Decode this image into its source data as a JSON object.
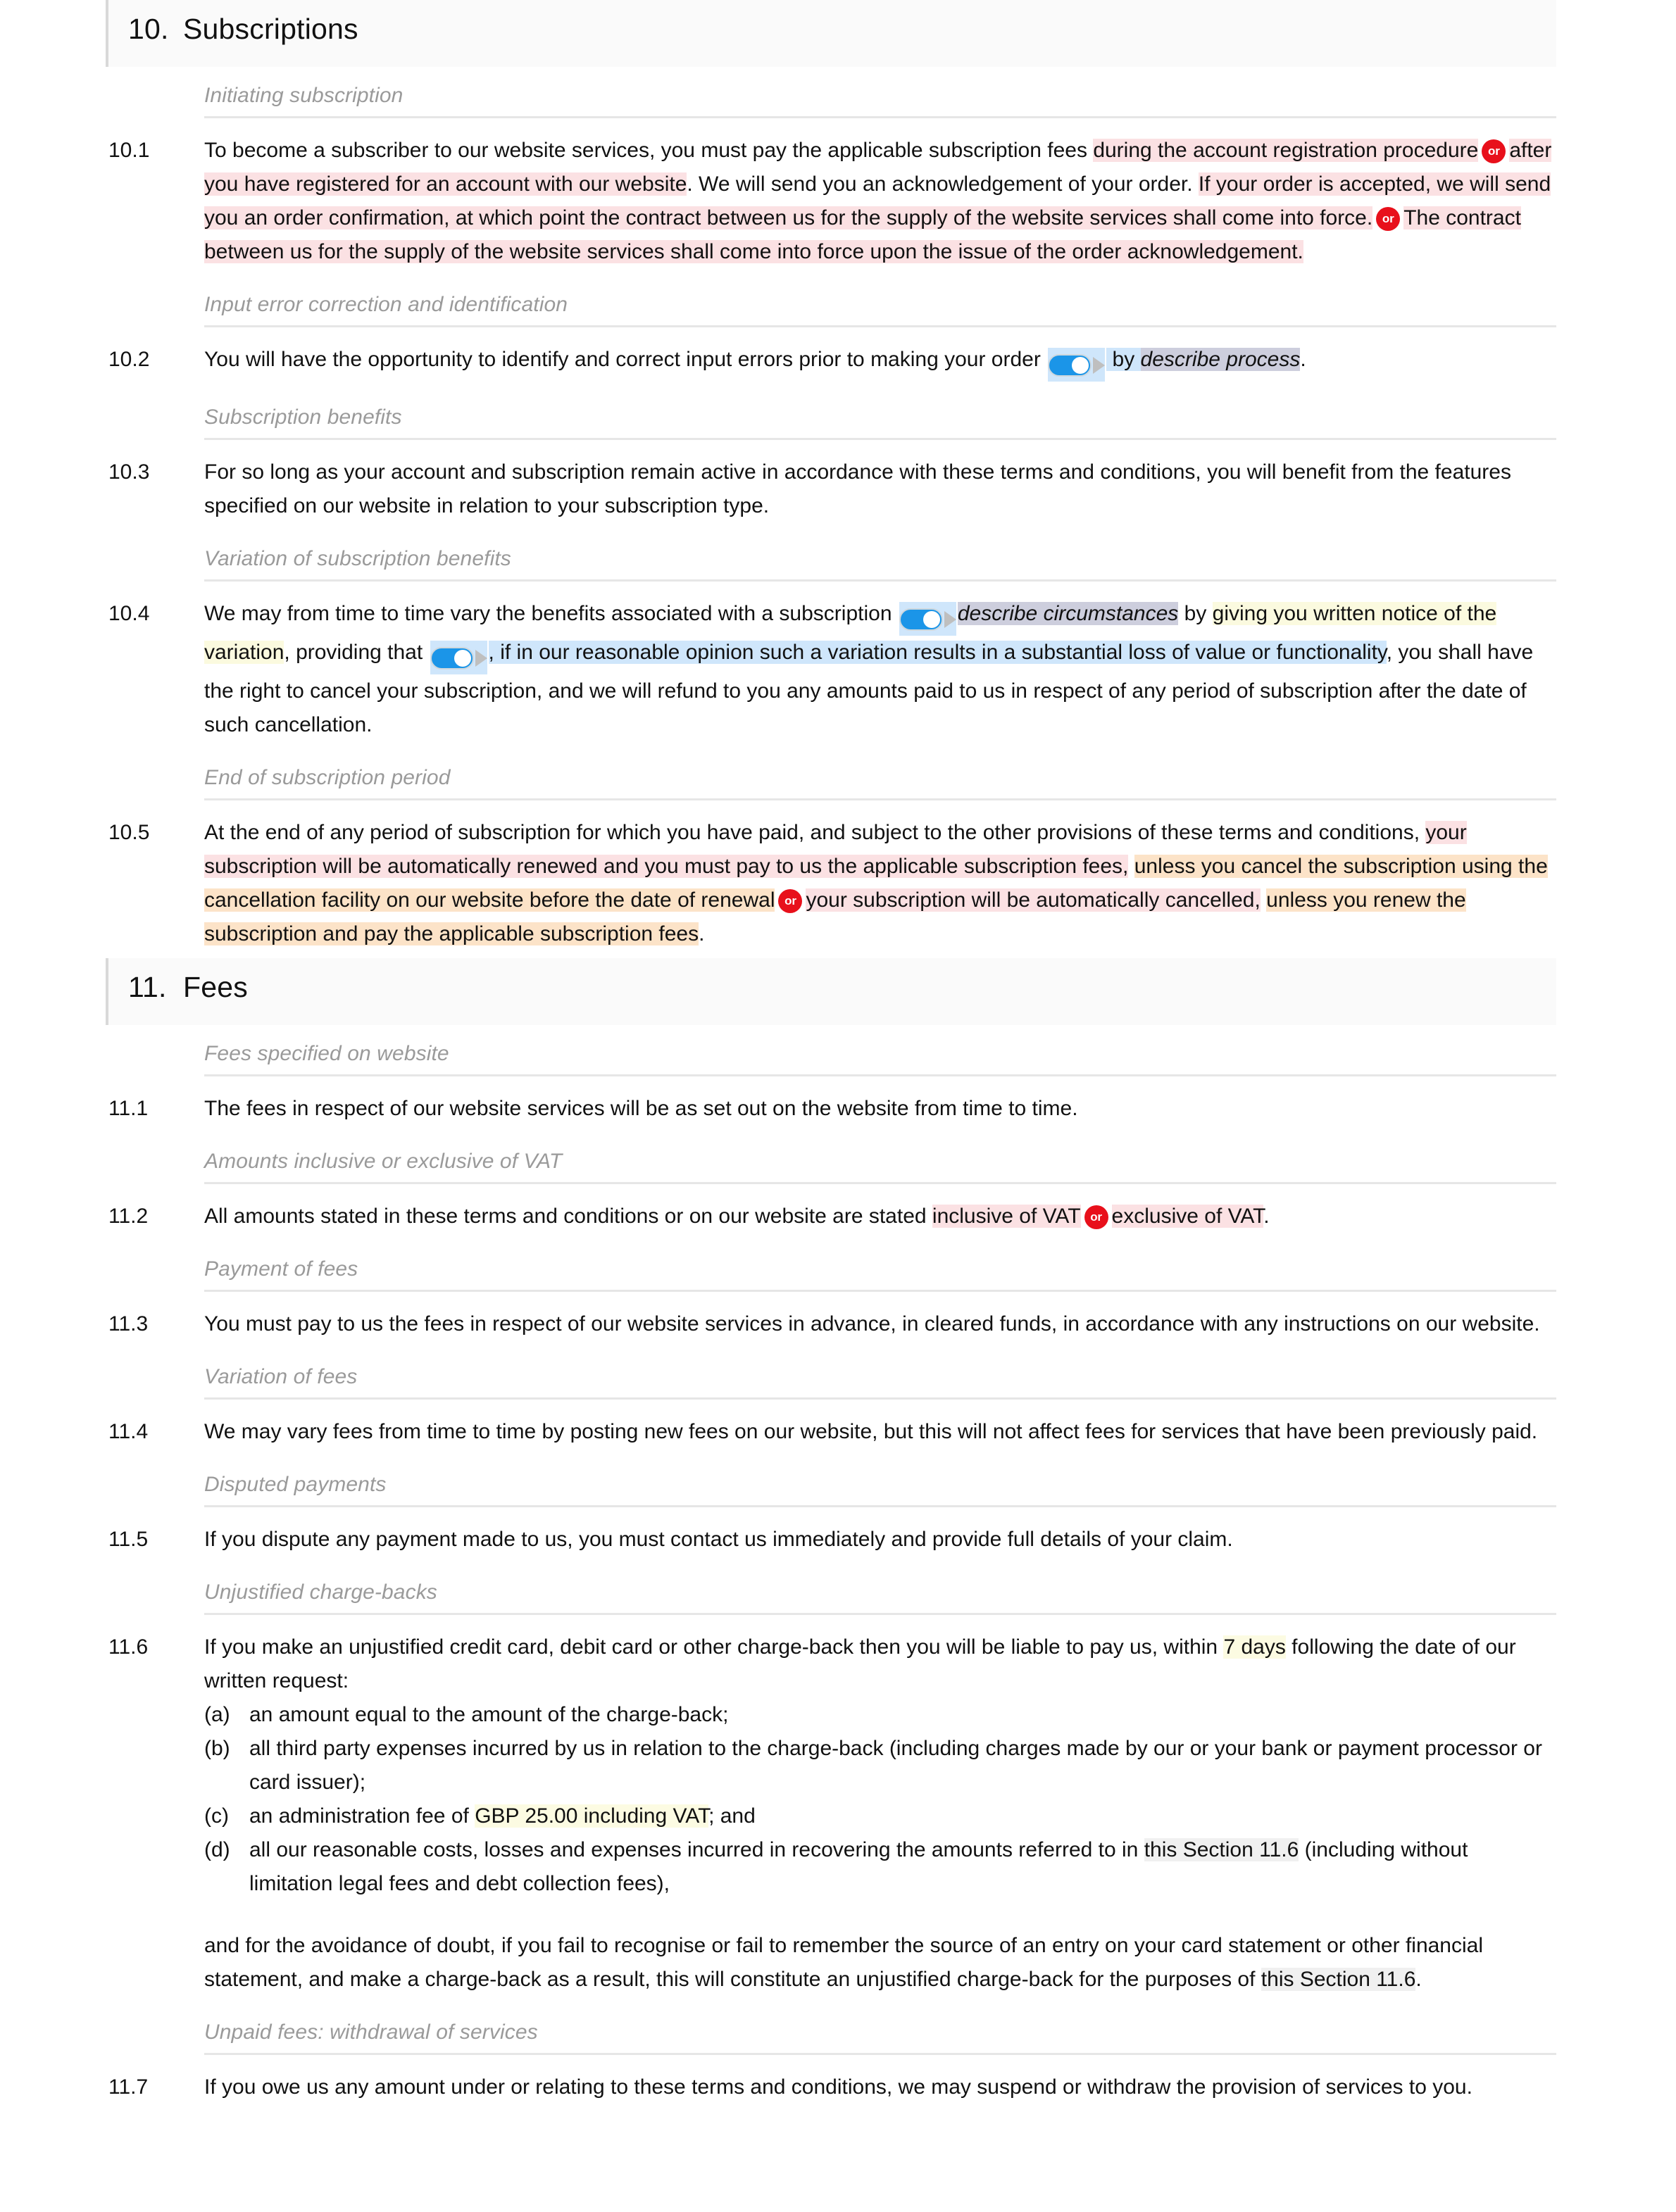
{
  "sections": [
    {
      "number": "10.",
      "title": "Subscriptions",
      "groups": [
        {
          "subheading": "Initiating subscription",
          "clauses": [
            {
              "number": "10.1",
              "runs": [
                {
                  "t": "To become a subscriber to our website services, you must pay the applicable subscription fees "
                },
                {
                  "t": "during the account registration procedure",
                  "hl": "pink"
                },
                {
                  "badge": "or"
                },
                {
                  "t": "after you have registered for an account with our website",
                  "hl": "pink"
                },
                {
                  "t": ". We will send you an acknowledgement of your order. "
                },
                {
                  "t": "If your order is accepted, we will send you an order confirmation, at which point the contract between us for the supply of the website services shall come into force.",
                  "hl": "pink"
                },
                {
                  "badge": "or"
                },
                {
                  "t": "The contract between us for the supply of the website services shall come into force upon the issue of the order acknowledgement.",
                  "hl": "pink"
                }
              ]
            }
          ]
        },
        {
          "subheading": "Input error correction and identification",
          "clauses": [
            {
              "number": "10.2",
              "runs": [
                {
                  "t": "You will have the opportunity to identify and correct input errors prior to making your order "
                },
                {
                  "toggle": true
                },
                {
                  "t": " by ",
                  "hl": "blue_plain"
                },
                {
                  "t": "describe process",
                  "hl": "lav",
                  "italic": true
                },
                {
                  "t": "."
                }
              ]
            }
          ]
        },
        {
          "subheading": "Subscription benefits",
          "clauses": [
            {
              "number": "10.3",
              "runs": [
                {
                  "t": "For so long as your account and subscription remain active in accordance with these terms and conditions, you will benefit from the features specified on our website in relation to your subscription type."
                }
              ]
            }
          ]
        },
        {
          "subheading": "Variation of subscription benefits",
          "clauses": [
            {
              "number": "10.4",
              "runs": [
                {
                  "t": "We may from time to time vary the benefits associated with a subscription "
                },
                {
                  "toggle": true
                },
                {
                  "t": "describe circumstances",
                  "hl": "lav",
                  "italic": true
                },
                {
                  "t": " by "
                },
                {
                  "t": "giving you written notice of the variation",
                  "hl": "yellow"
                },
                {
                  "t": ", providing that "
                },
                {
                  "toggle2": true
                },
                {
                  "t": ", if in our reasonable opinion such a variation results in a substantial loss of value or functionality",
                  "hl": "blue"
                },
                {
                  "t": ", you shall have the right to cancel your subscription, and we will refund to you any amounts paid to us in respect of any period of subscription after the date of such cancellation."
                }
              ]
            }
          ]
        },
        {
          "subheading": "End of subscription period",
          "clauses": [
            {
              "number": "10.5",
              "runs": [
                {
                  "t": "At the end of any period of subscription for which you have paid, and subject to the other provisions of these terms and conditions, "
                },
                {
                  "t": "your subscription will be automatically renewed and you must pay to us the applicable subscription fees,",
                  "hl": "pink"
                },
                {
                  "t": " "
                },
                {
                  "t": "unless you cancel the subscription using the cancellation facility on our website before the date of renewal",
                  "hl": "orange"
                },
                {
                  "badge": "or"
                },
                {
                  "t": "your subscription will be automatically cancelled,",
                  "hl": "pink"
                },
                {
                  "t": " "
                },
                {
                  "t": "unless you renew the subscription and pay the applicable subscription fees",
                  "hl": "orange"
                },
                {
                  "t": "."
                }
              ]
            }
          ]
        }
      ]
    },
    {
      "number": "11.",
      "title": "Fees",
      "groups": [
        {
          "subheading": "Fees specified on website",
          "clauses": [
            {
              "number": "11.1",
              "runs": [
                {
                  "t": "The fees in respect of our website services will be as set out on the website from time to time."
                }
              ]
            }
          ]
        },
        {
          "subheading": "Amounts inclusive or exclusive of VAT",
          "clauses": [
            {
              "number": "11.2",
              "runs": [
                {
                  "t": "All amounts stated in these terms and conditions or on our website are stated "
                },
                {
                  "t": "inclusive of VAT",
                  "hl": "pink"
                },
                {
                  "badge": "or"
                },
                {
                  "t": "exclusive of VAT",
                  "hl": "pink"
                },
                {
                  "t": "."
                }
              ]
            }
          ]
        },
        {
          "subheading": "Payment of fees",
          "clauses": [
            {
              "number": "11.3",
              "runs": [
                {
                  "t": "You must pay to us the fees in respect of our website services in advance, in cleared funds, in accordance with any instructions on our website."
                }
              ]
            }
          ]
        },
        {
          "subheading": "Variation of fees",
          "clauses": [
            {
              "number": "11.4",
              "runs": [
                {
                  "t": "We may vary fees from time to time by posting new fees on our website, but this will not affect fees for services that have been previously paid."
                }
              ]
            }
          ]
        },
        {
          "subheading": "Disputed payments",
          "clauses": [
            {
              "number": "11.5",
              "runs": [
                {
                  "t": "If you dispute any payment made to us, you must contact us immediately and provide full details of your claim."
                }
              ]
            }
          ]
        },
        {
          "subheading": "Unjustified charge-backs",
          "clauses": [
            {
              "number": "11.6",
              "runs": [
                {
                  "t": "If you make an unjustified credit card, debit card or other charge-back then you will be liable to pay us, within "
                },
                {
                  "t": "7 days",
                  "hl": "yellow2"
                },
                {
                  "t": " following the date of our written request:"
                }
              ],
              "subitems": [
                {
                  "letter": "(a)",
                  "runs": [
                    {
                      "t": "an amount equal to the amount of the charge-back;"
                    }
                  ]
                },
                {
                  "letter": "(b)",
                  "runs": [
                    {
                      "t": "all third party expenses incurred by us in relation to the charge-back (including charges made by our or your bank or payment processor or card issuer);"
                    }
                  ]
                },
                {
                  "letter": "(c)",
                  "runs": [
                    {
                      "t": "an administration fee of "
                    },
                    {
                      "t": "GBP 25.00 including VAT",
                      "hl": "yellow2"
                    },
                    {
                      "t": "; and"
                    }
                  ]
                },
                {
                  "letter": "(d)",
                  "runs": [
                    {
                      "t": "all our reasonable costs, losses and expenses incurred in recovering the amounts referred to in "
                    },
                    {
                      "t": "this Section 11.6",
                      "hl": "grey"
                    },
                    {
                      "t": " (including without limitation legal fees and debt collection fees),"
                    }
                  ]
                }
              ],
              "tail": [
                {
                  "t": "and for the avoidance of doubt, if you fail to recognise or fail to remember the source of an entry on your card statement or other financial statement, and make a charge-back as a result, this will constitute an unjustified charge-back for the purposes of "
                },
                {
                  "t": "this Section 11.6",
                  "hl": "grey"
                },
                {
                  "t": "."
                }
              ]
            }
          ]
        },
        {
          "subheading": "Unpaid fees: withdrawal of services",
          "clauses": [
            {
              "number": "11.7",
              "runs": [
                {
                  "t": "If you owe us any amount under or relating to these terms and conditions, we may suspend or withdraw the provision of services to you."
                }
              ]
            }
          ]
        }
      ]
    }
  ],
  "colors": {
    "highlight_pink": "#fbe1e3",
    "highlight_orange": "#fce3c8",
    "highlight_yellow": "#fbfadf",
    "highlight_blue": "#cfe6fb",
    "highlight_lavender": "#cdcedd",
    "highlight_grey": "#f0f0f0",
    "or_badge": "#e8101b",
    "toggle_on": "#1b95e8",
    "section_band": "#fafafa"
  },
  "icons": {
    "or_badge_label": "or",
    "toggle_name": "toggle-switch",
    "arrow_name": "triangle-right-icon"
  }
}
